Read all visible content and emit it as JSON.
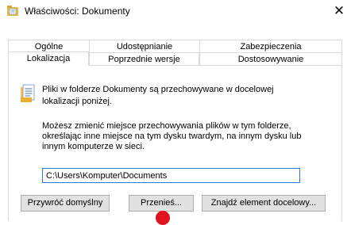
{
  "window": {
    "title": "Właściwości: Dokumenty",
    "close_glyph": "✕"
  },
  "tabs": {
    "row_back": [
      {
        "label": "Ogólne"
      },
      {
        "label": "Udostępnianie"
      },
      {
        "label": "Zabezpieczenia"
      }
    ],
    "row_front": [
      {
        "label": "Lokalizacja",
        "active": true
      },
      {
        "label": "Poprzednie wersje"
      },
      {
        "label": "Dostosowywanie"
      }
    ]
  },
  "panel": {
    "info_text": "Pliki w folderze Dokumenty są przechowywane w docelowej lokalizacji poniżej.",
    "description": "Możesz zmienić miejsce przechowywania plików w tym folderze, określając inne miejsce na tym dysku twardym, na innym dysku lub innym komputerze w sieci.",
    "path_value": "C:\\Users\\Komputer\\Documents"
  },
  "buttons": {
    "restore_default": "Przywróć domyślny",
    "move": "Przenieś...",
    "find_target": "Znajdź element docelowy..."
  },
  "icons": {
    "title": "folder-documents-icon",
    "info": "document-icon"
  },
  "colors": {
    "input_border": "#2b7bd6",
    "button_bg": "#e1e1e1",
    "cursor_marker": "#e0141e"
  }
}
